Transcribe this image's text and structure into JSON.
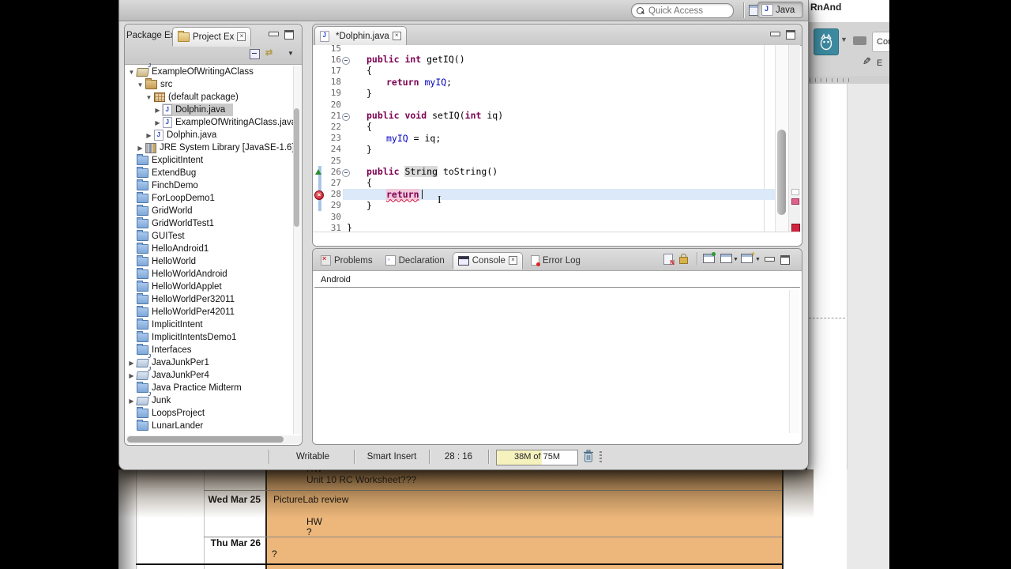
{
  "colors": {
    "keyword": "#7b0052",
    "field": "#0000c0",
    "current_line": "#dbe9f8",
    "calendar_orange": "#edb77b",
    "avatar_teal": "#3d8aa0",
    "error_red": "#cc2233"
  },
  "icons": {
    "search": "magnifier",
    "java_perspective": "J badge",
    "open_perspective": "window with plus",
    "folder": "blue closed folder",
    "open_folder": "open folder with J",
    "source_folder": "gold folder",
    "package": "crosshatch grid",
    "java_file": "white page with blue J",
    "library": "stacked books",
    "collapse_all": "minus box",
    "link_with_editor": "double arrows",
    "view_menu": "down triangle",
    "fold": "minus circle",
    "error": "red circle with x",
    "incoming_change": "green up triangle",
    "clear_console": "page with red N",
    "scroll_lock": "gold padlock",
    "pin_console": "window with green pin",
    "display_console": "window with caret",
    "open_console": "window with plus and caret",
    "minimize": "thin bar",
    "maximize": "square with top band",
    "close": "boxed x",
    "trash": "trash can",
    "comment_bubble": "speech bubble",
    "edit_pencil": "pencil",
    "text_cursor": "i-beam"
  },
  "toolbar": {
    "quick_access_placeholder": "Quick Access",
    "perspective_label": "Java"
  },
  "explorer": {
    "tab_package": "Package Ex",
    "tab_project": "Project Ex",
    "tree": [
      {
        "label": "ExampleOfWritingAClass",
        "depth": 0,
        "arrow": "expanded",
        "icon": "java-project-icon"
      },
      {
        "label": "src",
        "depth": 1,
        "arrow": "expanded",
        "icon": "source-folder-icon"
      },
      {
        "label": "(default package)",
        "depth": 2,
        "arrow": "expanded",
        "icon": "package-icon"
      },
      {
        "label": "Dolphin.java",
        "depth": 3,
        "arrow": "collapsed",
        "icon": "java-file-icon",
        "selected": true
      },
      {
        "label": "ExampleOfWritingAClass.java",
        "depth": 3,
        "arrow": "collapsed",
        "icon": "java-file-icon"
      },
      {
        "label": "Dolphin.java",
        "depth": 2,
        "arrow": "collapsed",
        "icon": "java-file-icon"
      },
      {
        "label": "JRE System Library [JavaSE-1.6]",
        "depth": 1,
        "arrow": "collapsed",
        "icon": "library-icon"
      },
      {
        "label": "ExplicitIntent",
        "depth": 0,
        "arrow": "none",
        "icon": "folder-icon"
      },
      {
        "label": "ExtendBug",
        "depth": 0,
        "arrow": "none",
        "icon": "folder-icon"
      },
      {
        "label": "FinchDemo",
        "depth": 0,
        "arrow": "none",
        "icon": "folder-icon"
      },
      {
        "label": "ForLoopDemo1",
        "depth": 0,
        "arrow": "none",
        "icon": "folder-icon"
      },
      {
        "label": "GridWorld",
        "depth": 0,
        "arrow": "none",
        "icon": "folder-icon"
      },
      {
        "label": "GridWorldTest1",
        "depth": 0,
        "arrow": "none",
        "icon": "folder-icon"
      },
      {
        "label": "GUITest",
        "depth": 0,
        "arrow": "none",
        "icon": "folder-icon"
      },
      {
        "label": "HelloAndroid1",
        "depth": 0,
        "arrow": "none",
        "icon": "folder-icon"
      },
      {
        "label": "HelloWorld",
        "depth": 0,
        "arrow": "none",
        "icon": "folder-icon"
      },
      {
        "label": "HelloWorldAndroid",
        "depth": 0,
        "arrow": "none",
        "icon": "folder-icon"
      },
      {
        "label": "HelloWorldApplet",
        "depth": 0,
        "arrow": "none",
        "icon": "folder-icon"
      },
      {
        "label": "HelloWorldPer32011",
        "depth": 0,
        "arrow": "none",
        "icon": "folder-icon"
      },
      {
        "label": "HelloWorldPer42011",
        "depth": 0,
        "arrow": "none",
        "icon": "folder-icon"
      },
      {
        "label": "ImplicitIntent",
        "depth": 0,
        "arrow": "none",
        "icon": "folder-icon"
      },
      {
        "label": "ImplicitIntentsDemo1",
        "depth": 0,
        "arrow": "none",
        "icon": "folder-icon"
      },
      {
        "label": "Interfaces",
        "depth": 0,
        "arrow": "none",
        "icon": "folder-icon"
      },
      {
        "label": "JavaJunkPer1",
        "depth": 0,
        "arrow": "collapsed",
        "icon": "open-folder-icon"
      },
      {
        "label": "JavaJunkPer4",
        "depth": 0,
        "arrow": "collapsed",
        "icon": "open-folder-icon"
      },
      {
        "label": "Java Practice Midterm",
        "depth": 0,
        "arrow": "none",
        "icon": "folder-icon"
      },
      {
        "label": "Junk",
        "depth": 0,
        "arrow": "collapsed",
        "icon": "open-folder-icon"
      },
      {
        "label": "LoopsProject",
        "depth": 0,
        "arrow": "none",
        "icon": "folder-icon"
      },
      {
        "label": "LunarLander",
        "depth": 0,
        "arrow": "none",
        "icon": "folder-icon"
      }
    ]
  },
  "editor": {
    "tab_title": "*Dolphin.java",
    "lines": [
      {
        "num": "15",
        "indent": 0,
        "parts": []
      },
      {
        "num": "16",
        "indent": 1,
        "fold": true,
        "parts": [
          [
            "public int ",
            "kw"
          ],
          [
            "getIQ()",
            "pl"
          ]
        ]
      },
      {
        "num": "17",
        "indent": 1,
        "parts": [
          [
            "{",
            "pl"
          ]
        ]
      },
      {
        "num": "18",
        "indent": 2,
        "parts": [
          [
            "return ",
            "kw"
          ],
          [
            "myIQ",
            "fld"
          ],
          [
            ";",
            "pl"
          ]
        ]
      },
      {
        "num": "19",
        "indent": 1,
        "parts": [
          [
            "}",
            "pl"
          ]
        ]
      },
      {
        "num": "20",
        "indent": 0,
        "parts": []
      },
      {
        "num": "21",
        "indent": 1,
        "fold": true,
        "parts": [
          [
            "public void ",
            "kw"
          ],
          [
            "setIQ(",
            "pl"
          ],
          [
            "int",
            "kw"
          ],
          [
            " iq)",
            "pl"
          ]
        ]
      },
      {
        "num": "22",
        "indent": 1,
        "parts": [
          [
            "{",
            "pl"
          ]
        ]
      },
      {
        "num": "23",
        "indent": 2,
        "parts": [
          [
            "myIQ",
            "fld"
          ],
          [
            " = iq;",
            "pl"
          ]
        ]
      },
      {
        "num": "24",
        "indent": 1,
        "parts": [
          [
            "}",
            "pl"
          ]
        ]
      },
      {
        "num": "25",
        "indent": 0,
        "parts": []
      },
      {
        "num": "26",
        "indent": 1,
        "fold": true,
        "tri": true,
        "qd": true,
        "parts": [
          [
            "public ",
            "kw"
          ],
          [
            "String",
            "occ"
          ],
          [
            " toString()",
            "pl"
          ]
        ]
      },
      {
        "num": "27",
        "indent": 1,
        "qd": true,
        "parts": [
          [
            "{",
            "pl"
          ]
        ]
      },
      {
        "num": "28",
        "indent": 2,
        "err": true,
        "qd": true,
        "cur": true,
        "caret": true,
        "parts": [
          [
            "return",
            "errw"
          ]
        ]
      },
      {
        "num": "29",
        "indent": 1,
        "qd": true,
        "parts": [
          [
            "}",
            "pl"
          ]
        ]
      },
      {
        "num": "30",
        "indent": 0,
        "parts": []
      },
      {
        "num": "31",
        "indent": 0,
        "parts": [
          [
            "}",
            "pl"
          ]
        ]
      }
    ]
  },
  "console": {
    "tabs": [
      {
        "label": "Problems",
        "icon": "problems-icon"
      },
      {
        "label": "Declaration",
        "icon": "declaration-icon"
      },
      {
        "label": "Console",
        "icon": "console-icon",
        "active": true
      },
      {
        "label": "Error Log",
        "icon": "error-log-icon"
      }
    ],
    "process_label": "Android"
  },
  "statusbar": {
    "writable": "Writable",
    "insert_mode": "Smart Insert",
    "caret_position": "28 : 16",
    "heap_usage": "38M of 75M"
  },
  "webpage": {
    "site_title": "RnAnd",
    "comment_button": "Com",
    "edit_label": "E",
    "calendar": {
      "top_row": {
        "hw": "HW",
        "worksheet": "Unit 10 RC Worksheet???"
      },
      "wed": {
        "date": "Wed Mar 25",
        "item": "PictureLab review",
        "hw": "HW",
        "q": "?"
      },
      "thu": {
        "date": "Thu Mar 26",
        "q": "?"
      }
    }
  }
}
